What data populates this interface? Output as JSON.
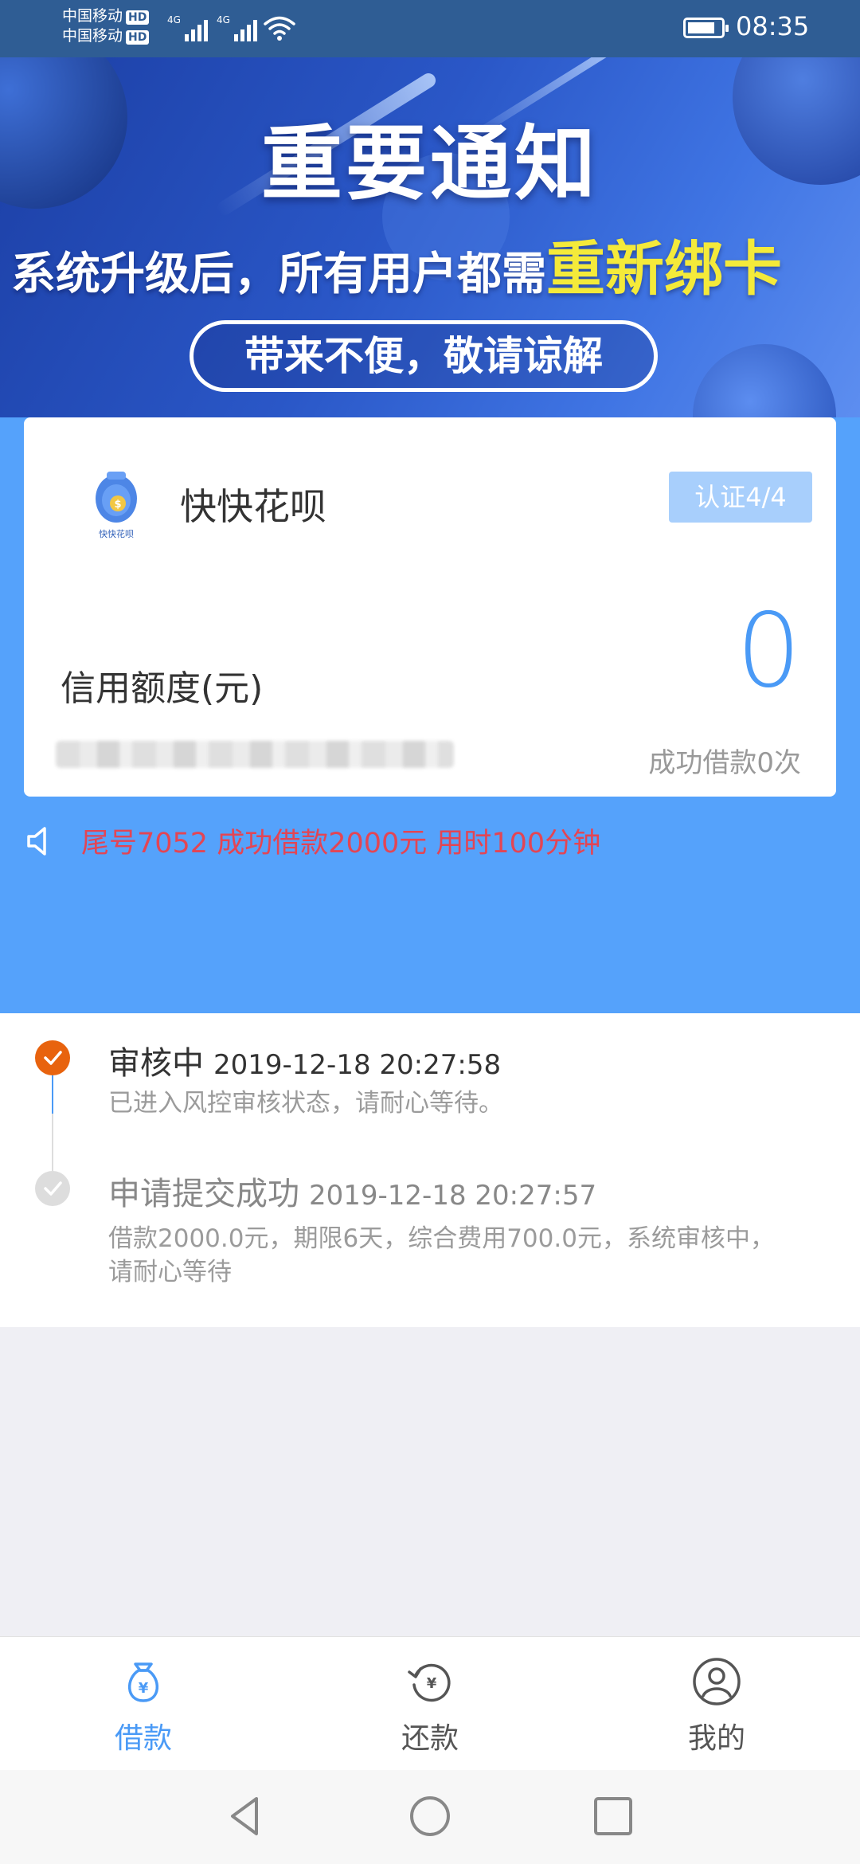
{
  "status_bar": {
    "carrier_1": "中国移动",
    "carrier_2": "中国移动",
    "hd_label": "HD",
    "network_1": "4G",
    "network_2": "4G",
    "time": "08:35",
    "battery_percent": 72
  },
  "banner": {
    "title": "重要通知",
    "subtitle_prefix": "系统升级后，所有用户都需",
    "subtitle_highlight": "重新绑卡",
    "pill_text": "带来不便，敬请谅解",
    "active_slide": 2,
    "slide_count": 4,
    "colors": {
      "highlight": "#f4ea3a"
    }
  },
  "card": {
    "logo_text": "快快花呗",
    "app_name": "快快花呗",
    "cert_button": "认证4/4",
    "credit_label": "信用额度(元)",
    "credit_value": "0",
    "success_loans": "成功借款0次"
  },
  "notice": {
    "icon": "speaker-icon",
    "text": "尾号7052 成功借款2000元 用时100分钟"
  },
  "timeline": [
    {
      "status": "active",
      "title": "审核中",
      "time": "2019-12-18 20:27:58",
      "description": "已进入风控审核状态，请耐心等待。"
    },
    {
      "status": "done",
      "title": "申请提交成功",
      "time": "2019-12-18 20:27:57",
      "description_line1": "借款2000.0元，期限6天，综合费用700.0元，系统审核中，",
      "description_line2": "请耐心等待"
    }
  ],
  "tabbar": [
    {
      "label": "借款",
      "icon": "money-bag-icon",
      "active": true
    },
    {
      "label": "还款",
      "icon": "repay-icon",
      "active": false
    },
    {
      "label": "我的",
      "icon": "user-icon",
      "active": false
    }
  ],
  "colors": {
    "primary_blue": "#55a2fb",
    "accent_orange": "#e8630e",
    "notice_red": "#e34554",
    "tab_active": "#4a9af6"
  }
}
